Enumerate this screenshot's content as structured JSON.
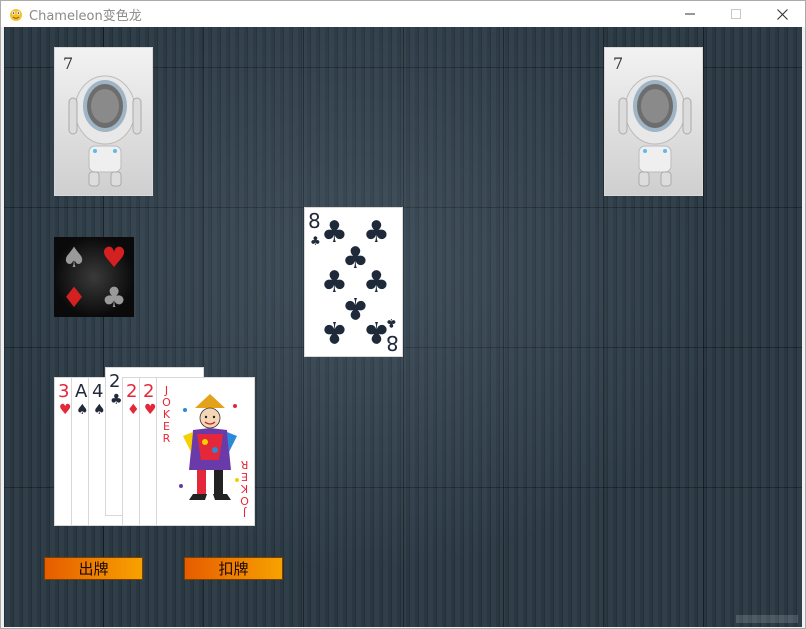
{
  "window": {
    "title": "Chameleon变色龙"
  },
  "opponents": [
    {
      "name": "left-opponent",
      "card_count": "7"
    },
    {
      "name": "right-opponent",
      "card_count": "7"
    }
  ],
  "table_card": {
    "rank": "8",
    "suit": "clubs"
  },
  "hand": [
    {
      "rank": "3",
      "suit": "hearts",
      "suit_glyph": "♥",
      "color": "#e4283a"
    },
    {
      "rank": "A",
      "suit": "spades",
      "suit_glyph": "♠",
      "color": "#222a3a"
    },
    {
      "rank": "4",
      "suit": "spades",
      "suit_glyph": "♠",
      "color": "#222a3a"
    },
    {
      "rank": "2",
      "suit": "clubs",
      "suit_glyph": "♣",
      "color": "#222a3a",
      "selected": true
    },
    {
      "rank": "2",
      "suit": "diamonds",
      "suit_glyph": "♦",
      "color": "#e4283a"
    },
    {
      "rank": "2",
      "suit": "hearts",
      "suit_glyph": "♥",
      "color": "#e4283a"
    }
  ],
  "joker": {
    "label": "JOKER"
  },
  "buttons": {
    "play": "出牌",
    "pass": "扣牌"
  },
  "icons": {
    "app": "chameleon-icon",
    "deck": "deck-suits-icon",
    "robot": "robot-avatar-icon"
  },
  "colors": {
    "button_start": "#e65c00",
    "button_end": "#f7a200",
    "table": "#2c3a45"
  }
}
